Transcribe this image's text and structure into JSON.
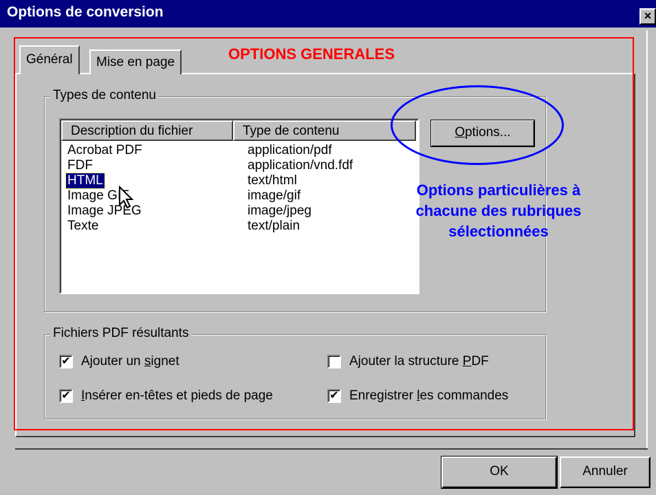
{
  "window": {
    "title": "Options de conversion",
    "close_glyph": "×"
  },
  "tabs": [
    {
      "label": "Général",
      "active": true
    },
    {
      "label": "Mise en page",
      "active": false
    }
  ],
  "annotation": {
    "heading": "OPTIONS GENERALES",
    "blue_line1": "Options particulières à",
    "blue_line2": "chacune des rubriques",
    "blue_line3": "sélectionnées",
    "red_color": "#ff0000",
    "blue_color": "#0000ff"
  },
  "types_group": {
    "legend": "Types de contenu",
    "columns": [
      "Description du fichier",
      "Type de contenu"
    ],
    "rows": [
      {
        "description": "Acrobat PDF",
        "type": "application/pdf",
        "selected": false
      },
      {
        "description": "FDF",
        "type": "application/vnd.fdf",
        "selected": false
      },
      {
        "description": "HTML",
        "type": "text/html",
        "selected": true
      },
      {
        "description": "Image GIF",
        "type": "image/gif",
        "selected": false
      },
      {
        "description": "Image JPEG",
        "type": "image/jpeg",
        "selected": false
      },
      {
        "description": "Texte",
        "type": "text/plain",
        "selected": false
      }
    ],
    "options_button": {
      "prefix": "",
      "mnemonic": "O",
      "rest": "ptions..."
    }
  },
  "pdf_group": {
    "legend": "Fichiers PDF résultants",
    "checkboxes": [
      {
        "pre": "Ajouter un ",
        "mnemonic": "s",
        "post": "ignet",
        "checked": true
      },
      {
        "pre": "",
        "mnemonic": "I",
        "post": "nsérer en-têtes et pieds de page",
        "checked": true
      },
      {
        "pre": "Ajouter la structure ",
        "mnemonic": "P",
        "post": "DF",
        "checked": false
      },
      {
        "pre": "Enregistrer ",
        "mnemonic": "l",
        "post": "es commandes",
        "checked": true
      }
    ]
  },
  "footer": {
    "ok_label": "OK",
    "cancel_label": "Annuler"
  },
  "icons": {
    "cursor": "arrow-cursor-icon",
    "check": "✔"
  }
}
